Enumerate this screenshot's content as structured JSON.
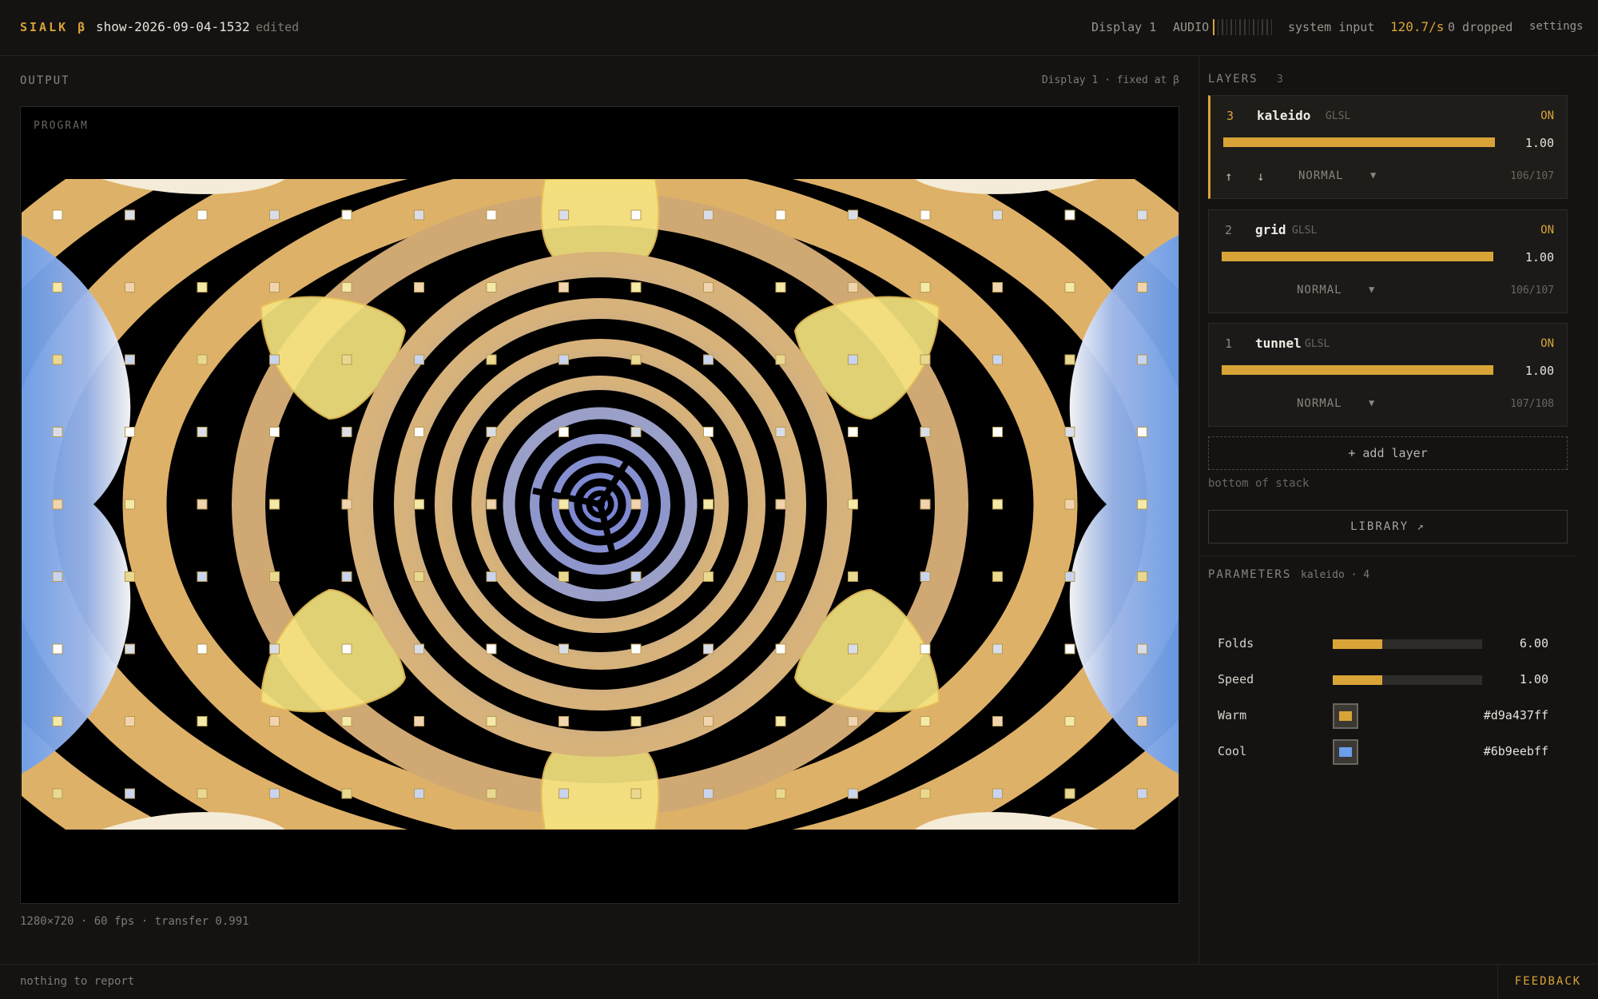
{
  "app": {
    "brand": "SIALK β",
    "show_name": "show-2026-09-04-1532",
    "edited": "edited"
  },
  "topbar": {
    "display": "Display 1",
    "audio_label": "AUDIO",
    "audio_level": 0.07,
    "audio_input": "system input",
    "rate": "120.7/s",
    "dropped": "0 dropped",
    "settings": "settings"
  },
  "output": {
    "title": "OUTPUT",
    "info": "Display 1 · fixed at β",
    "program_label": "PROGRAM",
    "meta": "1280×720 · 60 fps · transfer 0.991"
  },
  "layers": {
    "title": "LAYERS",
    "count": "3",
    "items": [
      {
        "num": "3",
        "name": "kaleido",
        "type": "GLSL",
        "state": "ON",
        "opacity": 1.0,
        "opacity_label": "1.00",
        "blend": "NORMAL",
        "frames": "106/107",
        "active": true,
        "up": "↑",
        "down": "↓"
      },
      {
        "num": "2",
        "name": "grid",
        "type": "GLSL",
        "state": "ON",
        "opacity": 1.0,
        "opacity_label": "1.00",
        "blend": "NORMAL",
        "frames": "106/107",
        "active": false
      },
      {
        "num": "1",
        "name": "tunnel",
        "type": "GLSL",
        "state": "ON",
        "opacity": 1.0,
        "opacity_label": "1.00",
        "blend": "NORMAL",
        "frames": "107/108",
        "active": false
      }
    ],
    "add_label": "+ add layer",
    "bottom_note": "bottom of stack",
    "library_label": "LIBRARY ↗"
  },
  "parameters": {
    "title": "PARAMETERS",
    "subtitle": "kaleido · 4",
    "sliders": [
      {
        "label": "Folds",
        "value": "6.00",
        "fraction": 0.33
      },
      {
        "label": "Speed",
        "value": "1.00",
        "fraction": 0.33
      }
    ],
    "colors": [
      {
        "label": "Warm",
        "value": "#d9a437ff",
        "color": "#d9a437"
      },
      {
        "label": "Cool",
        "value": "#6b9eebff",
        "color": "#6b9eeb"
      }
    ]
  },
  "status": {
    "message": "nothing to report",
    "feedback": "FEEDBACK"
  },
  "colors": {
    "accent": "#d9a437",
    "cool": "#6b9eeb",
    "background": "#141312"
  }
}
